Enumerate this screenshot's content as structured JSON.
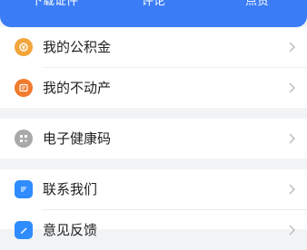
{
  "top_tabs": {
    "tab1": "下载证件",
    "tab2": "评论",
    "tab3": "点赞"
  },
  "colors": {
    "header": "#3a7df6",
    "housing_fund_icon": "#f2a53a",
    "real_estate_icon": "#f07a2c",
    "health_code_icon": "#a9a9a9",
    "contact_icon": "#2f8cff",
    "feedback_icon": "#2f8cff"
  },
  "menu": {
    "housing_fund": {
      "label": "我的公积金",
      "icon": "housing-fund-icon"
    },
    "real_estate": {
      "label": "我的不动产",
      "icon": "real-estate-icon"
    },
    "health_code": {
      "label": "电子健康码",
      "icon": "qr-code-icon"
    },
    "contact_us": {
      "label": "联系我们",
      "icon": "chat-icon"
    },
    "feedback": {
      "label": "意见反馈",
      "icon": "feedback-icon"
    }
  }
}
